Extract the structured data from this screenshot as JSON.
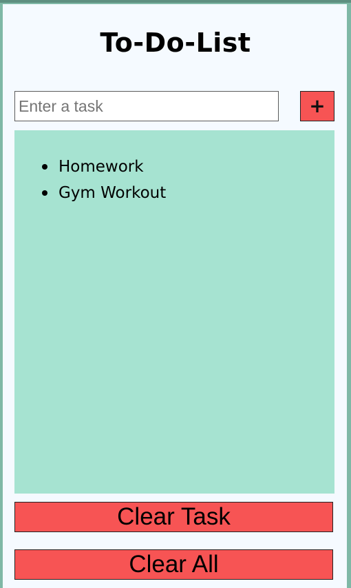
{
  "app": {
    "title": "To-Do-List"
  },
  "input": {
    "placeholder": "Enter a task",
    "value": ""
  },
  "add_button": {
    "label": "+"
  },
  "tasks": [
    {
      "label": "Homework"
    },
    {
      "label": "Gym Workout"
    }
  ],
  "actions": {
    "clear_task_label": "Clear Task",
    "clear_all_label": "Clear All"
  },
  "colors": {
    "page_background": "#7fb8a6",
    "card_background": "#f5faff",
    "list_background": "#a6e3d1",
    "button_red": "#f75454"
  }
}
